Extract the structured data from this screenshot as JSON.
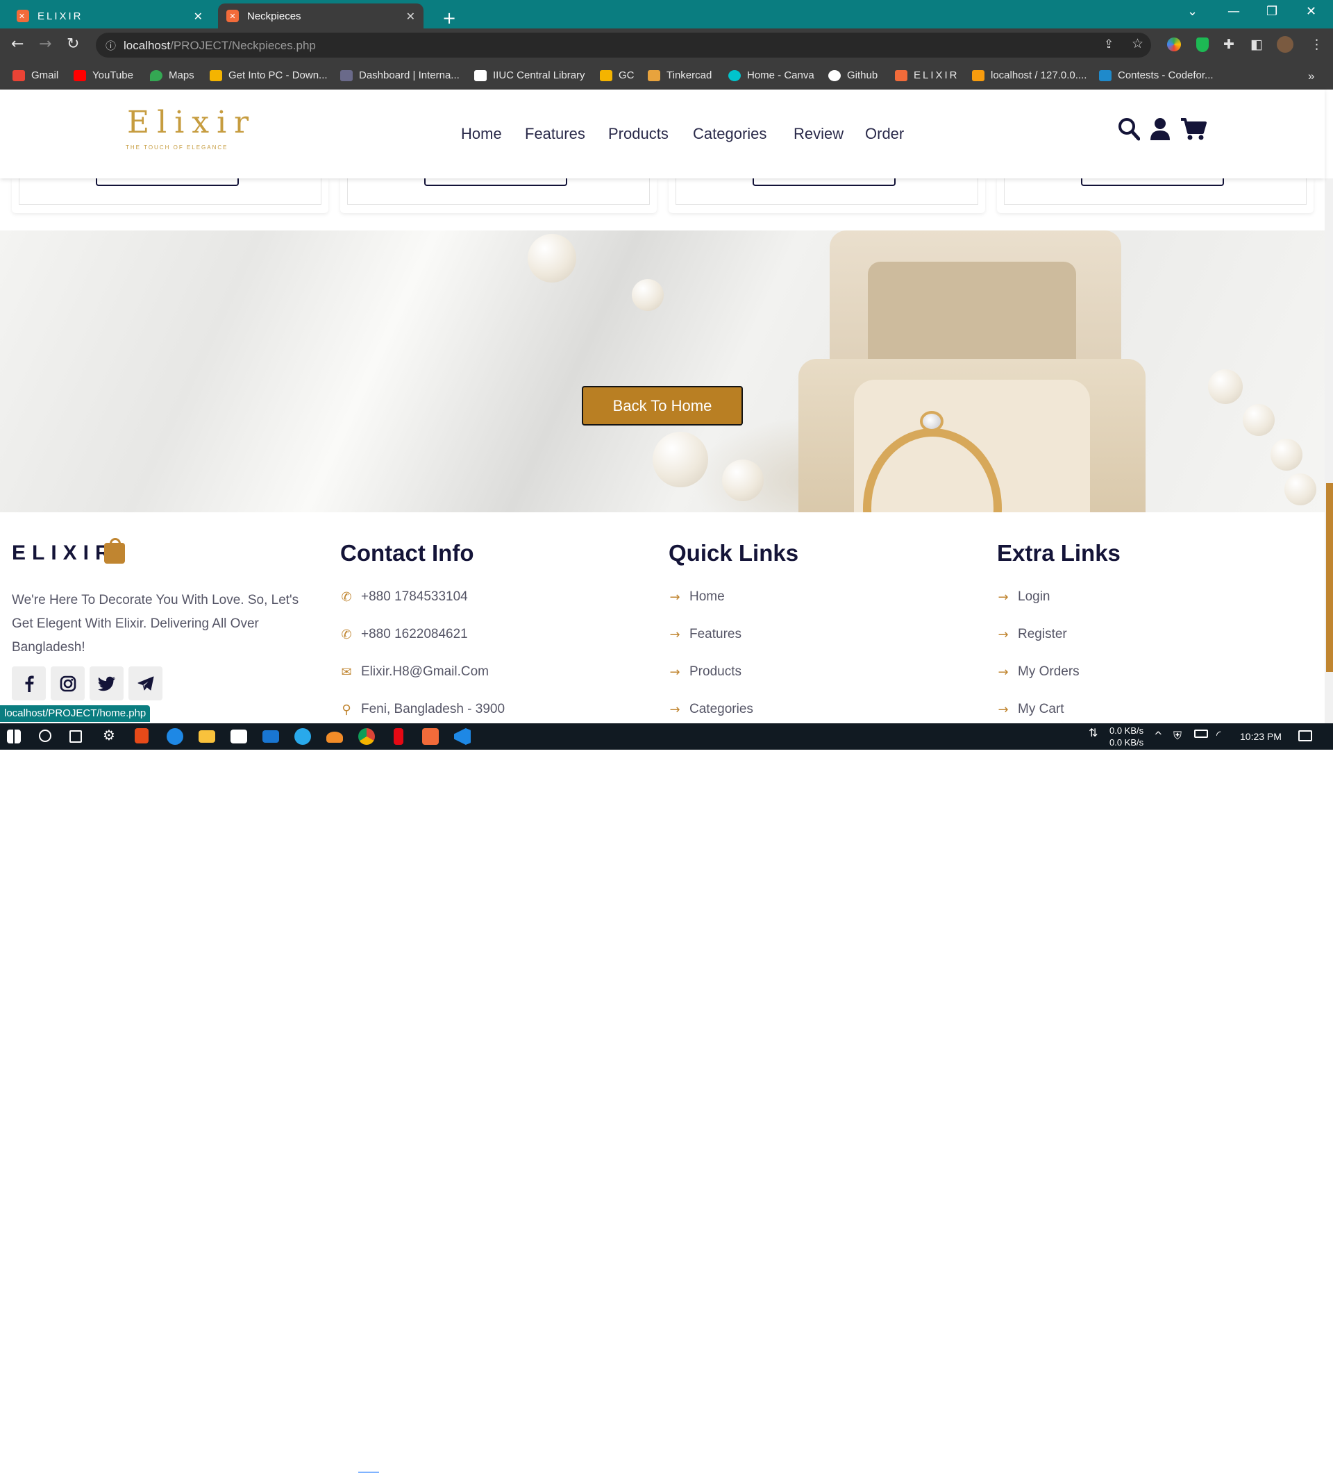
{
  "browser": {
    "tabs": [
      {
        "title": "ELIXIR",
        "favicon": "xampp-icon"
      },
      {
        "title": "Neckpieces",
        "favicon": "xampp-icon"
      }
    ],
    "new_tab": "+",
    "url_host": "localhost",
    "url_path": "/PROJECT/Neckpieces.php",
    "bookmarks": [
      {
        "label": "Gmail",
        "color": "#ea4335"
      },
      {
        "label": "YouTube",
        "color": "#ff0000"
      },
      {
        "label": "Maps",
        "color": "#34a853"
      },
      {
        "label": "Get Into PC - Down...",
        "color": "#f4b400"
      },
      {
        "label": "Dashboard | Interna...",
        "color": "#4a4a6a"
      },
      {
        "label": "IIUC Central Library",
        "color": "#ffffff"
      },
      {
        "label": "GC",
        "color": "#1e8e3e"
      },
      {
        "label": "Tinkercad",
        "color": "#e8a33d"
      },
      {
        "label": "Home - Canva",
        "color": "#00c4cc"
      },
      {
        "label": "Github",
        "color": "#ffffff"
      },
      {
        "label": "ELIXIR",
        "color": "#f26b3a"
      },
      {
        "label": "localhost / 127.0.0....",
        "color": "#f89c0e"
      },
      {
        "label": "Contests - Codefor...",
        "color": "#1f8acb"
      }
    ],
    "bookmarks_overflow": "»",
    "status_url": "localhost/PROJECT/home.php"
  },
  "site": {
    "logo": {
      "word": "Elixir",
      "tagline": "THE TOUCH OF ELEGANCE"
    },
    "nav": [
      "Home",
      "Features",
      "Products",
      "Categories",
      "Review",
      "Order"
    ],
    "header_icons": [
      "search-icon",
      "user-icon",
      "cart-icon"
    ],
    "hero_button": "Back To Home",
    "footer": {
      "brand": "ELIXIR",
      "about": "We're Here To Decorate You With Love. So, Let's Get Elegent With Elixir. Delivering All Over Bangladesh!",
      "social": [
        "facebook-icon",
        "instagram-icon",
        "twitter-icon",
        "telegram-icon"
      ],
      "contact": {
        "title": "Contact Info",
        "items": [
          "+880 1784533104",
          "+880 1622084621",
          "Elixir.H8@Gmail.Com",
          "Feni, Bangladesh - 3900"
        ]
      },
      "quick_links": {
        "title": "Quick Links",
        "items": [
          "Home",
          "Features",
          "Products",
          "Categories"
        ]
      },
      "extra_links": {
        "title": "Extra Links",
        "items": [
          "Login",
          "Register",
          "My Orders",
          "My Cart"
        ]
      }
    },
    "colors": {
      "accent": "#c08530",
      "navy": "#141438",
      "button": "#b97f23"
    }
  },
  "taskbar": {
    "net_down": "0.0 KB/s",
    "net_up": "0.0 KB/s",
    "time": "10:23 PM"
  }
}
